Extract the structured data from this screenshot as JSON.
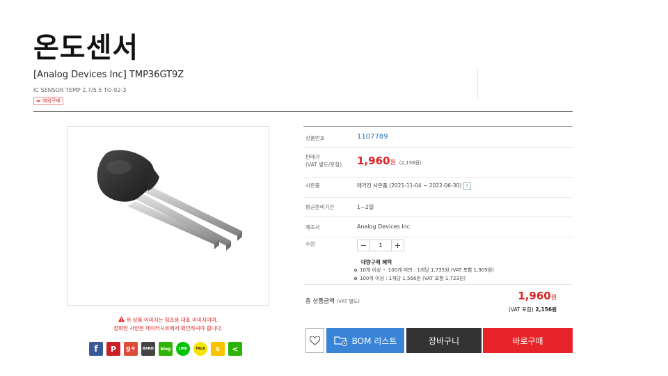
{
  "header": {
    "category_title": "온도센서",
    "product_name": "[Analog Devices Inc] TMP36GT9Z",
    "product_description": "IC SENSOR TEMP 2.7/5.5 TO-92-3",
    "overseas_badge": "해외구매"
  },
  "gallery": {
    "notice_line1": "위 상품 이미지는 참조용 대표 이미지이며,",
    "notice_line2": "정확한 사양은 데이터시트에서 확인하셔야 합니다.",
    "share_icons": [
      {
        "name": "facebook",
        "glyph": "f",
        "color": "#3b5998"
      },
      {
        "name": "pinterest",
        "glyph": "P",
        "color": "#cb2027"
      },
      {
        "name": "google-plus",
        "glyph": "g+",
        "color": "#dd4b39"
      },
      {
        "name": "band",
        "glyph": "BAND",
        "color": "#444444"
      },
      {
        "name": "blog",
        "glyph": "blog",
        "color": "#2db400"
      },
      {
        "name": "line",
        "glyph": "LINE",
        "color": "#00c300"
      },
      {
        "name": "kakaotalk",
        "glyph": "TALK",
        "color": "#f7e600"
      },
      {
        "name": "kakaostory",
        "glyph": "s",
        "color": "#f9c300"
      },
      {
        "name": "share",
        "glyph": "<",
        "color": "#2db400"
      }
    ]
  },
  "info": {
    "code_label": "상품번호",
    "code_value": "1107789",
    "price_label_1": "판매가",
    "price_label_2": "(VAT 별도/포함)",
    "price_value": "1,960",
    "price_unit": "원",
    "price_vat": "(2,156원)",
    "coupon_label": "사은품",
    "coupon_value": "매거진 사은품 (2021-11-04 ~ 2022-06-30)",
    "coupon_help": "?",
    "leadtime_label": "평균준비기간",
    "leadtime_value": "1~2일",
    "maker_label": "제조사",
    "maker_value": "Analog Devices Inc",
    "qty_label": "수량",
    "qty_minus": "−",
    "qty_value": "1",
    "qty_plus": "+",
    "bulk_title": "대량구매 혜택",
    "bulk_items": [
      "10개 이상 ~ 100개 미만 : 1개당 1,735원 (VAT 포함 1,909원)",
      "100개 이상 : 1개당 1,566원 (VAT 포함 1,723원)"
    ]
  },
  "total": {
    "label": "총 상품금액",
    "label_note": "(VAT 별도)",
    "price": "1,960",
    "unit": "원",
    "vat_prefix": "(VAT 포함)",
    "vat_value": "2,156원"
  },
  "actions": {
    "bom_label": "BOM 리스트",
    "cart_label": "장바구니",
    "buy_label": "바로구매"
  },
  "colors": {
    "accent_red": "#e8242b",
    "bom_blue": "#3a84d8",
    "cart_dark": "#333333",
    "link_blue": "#2f6fb8"
  }
}
